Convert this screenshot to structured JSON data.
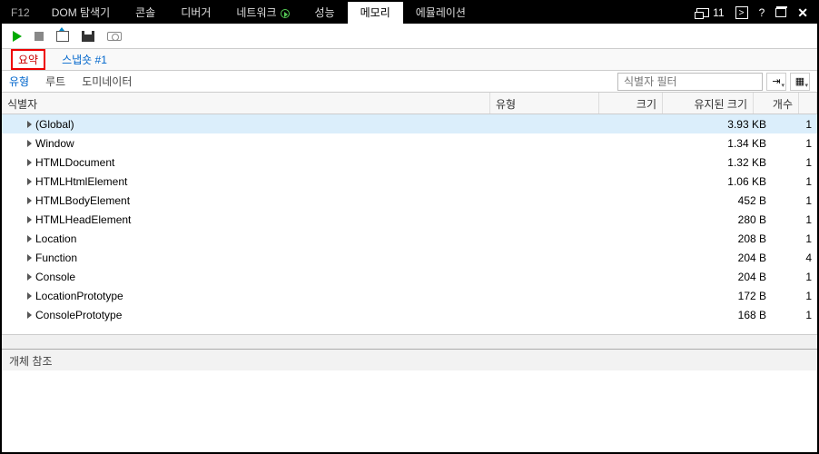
{
  "menubar": {
    "f12": "F12",
    "tabs": [
      {
        "label": "DOM 탐색기"
      },
      {
        "label": "콘솔"
      },
      {
        "label": "디버거"
      },
      {
        "label": "네트워크"
      },
      {
        "label": "성능"
      },
      {
        "label": "메모리"
      },
      {
        "label": "에뮬레이션"
      }
    ],
    "error_count": "11",
    "help": "?"
  },
  "subtabs": {
    "summary": "요약",
    "snapshot": "스냅숏 #1"
  },
  "filtertabs": [
    {
      "label": "유형"
    },
    {
      "label": "루트"
    },
    {
      "label": "도미네이터"
    }
  ],
  "filter_placeholder": "식별자 필터",
  "columns": {
    "id": "식별자",
    "type": "유형",
    "size": "크기",
    "retained": "유지된 크기",
    "count": "개수"
  },
  "rows": [
    {
      "name": "(Global)",
      "retained": "3.93 KB",
      "count": "1",
      "selected": true
    },
    {
      "name": "Window",
      "retained": "1.34 KB",
      "count": "1"
    },
    {
      "name": "HTMLDocument",
      "retained": "1.32 KB",
      "count": "1"
    },
    {
      "name": "HTMLHtmlElement",
      "retained": "1.06 KB",
      "count": "1"
    },
    {
      "name": "HTMLBodyElement",
      "retained": "452 B",
      "count": "1"
    },
    {
      "name": "HTMLHeadElement",
      "retained": "280 B",
      "count": "1"
    },
    {
      "name": "Location",
      "retained": "208 B",
      "count": "1"
    },
    {
      "name": "Function",
      "retained": "204 B",
      "count": "4"
    },
    {
      "name": "Console",
      "retained": "204 B",
      "count": "1"
    },
    {
      "name": "LocationPrototype",
      "retained": "172 B",
      "count": "1"
    },
    {
      "name": "ConsolePrototype",
      "retained": "168 B",
      "count": "1"
    }
  ],
  "refs_label": "개체 참조"
}
